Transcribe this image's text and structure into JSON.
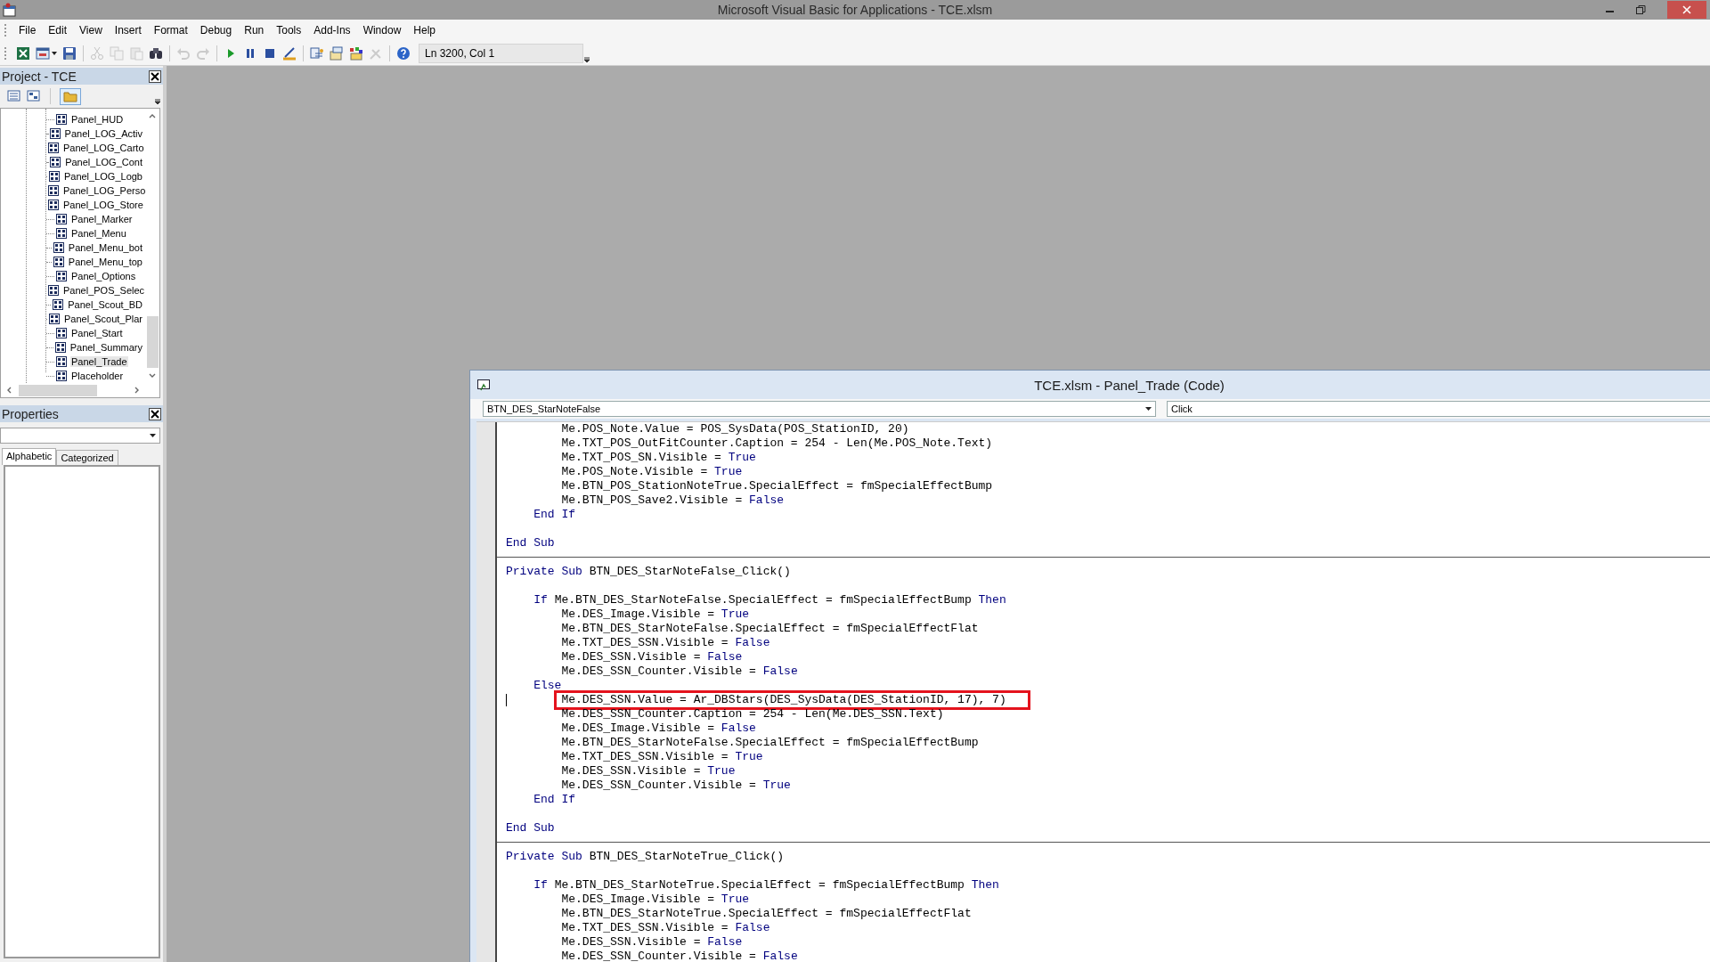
{
  "window": {
    "title": "Microsoft Visual Basic for Applications - TCE.xlsm"
  },
  "menu": [
    "File",
    "Edit",
    "View",
    "Insert",
    "Format",
    "Debug",
    "Run",
    "Tools",
    "Add-Ins",
    "Window",
    "Help"
  ],
  "toolbar": {
    "groups": [
      [
        {
          "kind": "excel",
          "disabled": false
        },
        {
          "kind": "userform",
          "disabled": false
        },
        {
          "kind": "save",
          "disabled": false
        }
      ],
      [
        {
          "kind": "cut",
          "disabled": true
        },
        {
          "kind": "copy",
          "disabled": true
        },
        {
          "kind": "paste",
          "disabled": true
        },
        {
          "kind": "find",
          "disabled": false
        }
      ],
      [
        {
          "kind": "undo",
          "disabled": true
        },
        {
          "kind": "redo",
          "disabled": true
        }
      ],
      [
        {
          "kind": "run",
          "disabled": false
        },
        {
          "kind": "pause",
          "disabled": false
        },
        {
          "kind": "stop",
          "disabled": false
        },
        {
          "kind": "design",
          "disabled": false
        }
      ],
      [
        {
          "kind": "project",
          "disabled": false
        },
        {
          "kind": "properties",
          "disabled": false
        },
        {
          "kind": "browser",
          "disabled": false
        },
        {
          "kind": "toolbox",
          "disabled": true
        }
      ],
      [
        {
          "kind": "help",
          "disabled": false
        }
      ]
    ],
    "position": "Ln 3200, Col 1"
  },
  "project": {
    "title": "Project - TCE",
    "items": [
      {
        "label": "Panel_HUD",
        "selected": false
      },
      {
        "label": "Panel_LOG_Activ",
        "selected": false
      },
      {
        "label": "Panel_LOG_Carto",
        "selected": false
      },
      {
        "label": "Panel_LOG_Cont",
        "selected": false
      },
      {
        "label": "Panel_LOG_Logb",
        "selected": false
      },
      {
        "label": "Panel_LOG_Perso",
        "selected": false
      },
      {
        "label": "Panel_LOG_Store",
        "selected": false
      },
      {
        "label": "Panel_Marker",
        "selected": false
      },
      {
        "label": "Panel_Menu",
        "selected": false
      },
      {
        "label": "Panel_Menu_bot",
        "selected": false
      },
      {
        "label": "Panel_Menu_top",
        "selected": false
      },
      {
        "label": "Panel_Options",
        "selected": false
      },
      {
        "label": "Panel_POS_Selec",
        "selected": false
      },
      {
        "label": "Panel_Scout_BD",
        "selected": false
      },
      {
        "label": "Panel_Scout_Plar",
        "selected": false
      },
      {
        "label": "Panel_Start",
        "selected": false
      },
      {
        "label": "Panel_Summary",
        "selected": false
      },
      {
        "label": "Panel_Trade",
        "selected": true
      },
      {
        "label": "Placeholder",
        "selected": false
      }
    ]
  },
  "properties": {
    "title": "Properties",
    "tabs": [
      {
        "label": "Alphabetic",
        "selected": true
      },
      {
        "label": "Categorized",
        "selected": false
      }
    ]
  },
  "code_window": {
    "title": "TCE.xlsm - Panel_Trade (Code)",
    "object": "BTN_DES_StarNoteFalse",
    "procedure": "Click",
    "procedures": [
      {
        "blocks": [
          [
            {
              "tokens": [
                {
                  "text": "        Me.POS_Note.Value = POS_SysData(POS_StationID, 20)",
                  "kind": "plain"
                }
              ],
              "highlighted": false
            },
            {
              "tokens": [
                {
                  "text": "        Me.TXT_POS_OutFitCounter.Caption = 254 - Len(Me.POS_Note.Text)",
                  "kind": "plain"
                }
              ],
              "highlighted": false
            },
            {
              "tokens": [
                {
                  "text": "        Me.TXT_POS_SN.Visible = ",
                  "kind": "plain"
                },
                {
                  "text": "True",
                  "kind": "keyword"
                }
              ],
              "highlighted": false
            },
            {
              "tokens": [
                {
                  "text": "        Me.POS_Note.Visible = ",
                  "kind": "plain"
                },
                {
                  "text": "True",
                  "kind": "keyword"
                }
              ],
              "highlighted": false
            },
            {
              "tokens": [
                {
                  "text": "        Me.BTN_POS_StationNoteTrue.SpecialEffect = fmSpecialEffectBump",
                  "kind": "plain"
                }
              ],
              "highlighted": false
            },
            {
              "tokens": [
                {
                  "text": "        Me.BTN_POS_Save2.Visible = ",
                  "kind": "plain"
                },
                {
                  "text": "False",
                  "kind": "keyword"
                }
              ],
              "highlighted": false
            },
            {
              "tokens": [
                {
                  "text": "    End If",
                  "kind": "keyword"
                }
              ],
              "highlighted": false
            }
          ],
          [
            {
              "tokens": [
                {
                  "text": "End Sub",
                  "kind": "keyword"
                }
              ],
              "highlighted": false
            }
          ]
        ]
      },
      {
        "blocks": [
          [
            {
              "tokens": [
                {
                  "text": "Private Sub",
                  "kind": "keyword"
                },
                {
                  "text": " BTN_DES_StarNoteFalse_Click()",
                  "kind": "plain"
                }
              ],
              "highlighted": false
            }
          ],
          [
            {
              "tokens": [
                {
                  "text": "    If",
                  "kind": "keyword"
                },
                {
                  "text": " Me.BTN_DES_StarNoteFalse.SpecialEffect = fmSpecialEffectBump ",
                  "kind": "plain"
                },
                {
                  "text": "Then",
                  "kind": "keyword"
                }
              ],
              "highlighted": false
            },
            {
              "tokens": [
                {
                  "text": "        Me.DES_Image.Visible = ",
                  "kind": "plain"
                },
                {
                  "text": "True",
                  "kind": "keyword"
                }
              ],
              "highlighted": false
            },
            {
              "tokens": [
                {
                  "text": "        Me.BTN_DES_StarNoteFalse.SpecialEffect = fmSpecialEffectFlat",
                  "kind": "plain"
                }
              ],
              "highlighted": false
            },
            {
              "tokens": [
                {
                  "text": "        Me.TXT_DES_SSN.Visible = ",
                  "kind": "plain"
                },
                {
                  "text": "False",
                  "kind": "keyword"
                }
              ],
              "highlighted": false
            },
            {
              "tokens": [
                {
                  "text": "        Me.DES_SSN.Visible = ",
                  "kind": "plain"
                },
                {
                  "text": "False",
                  "kind": "keyword"
                }
              ],
              "highlighted": false
            },
            {
              "tokens": [
                {
                  "text": "        Me.DES_SSN_Counter.Visible = ",
                  "kind": "plain"
                },
                {
                  "text": "False",
                  "kind": "keyword"
                }
              ],
              "highlighted": false
            },
            {
              "tokens": [
                {
                  "text": "    Else",
                  "kind": "keyword"
                }
              ],
              "highlighted": false
            },
            {
              "tokens": [
                {
                  "text": "        Me.DES_SSN.Value = Ar_DBStars(DES_SysData(DES_StationID, 17), 7)",
                  "kind": "plain"
                }
              ],
              "highlighted": true,
              "cursor": true
            },
            {
              "tokens": [
                {
                  "text": "        Me.DES_SSN_Counter.Caption = 254 - Len(Me.DES_SSN.Text)",
                  "kind": "plain"
                }
              ],
              "highlighted": false
            },
            {
              "tokens": [
                {
                  "text": "        Me.DES_Image.Visible = ",
                  "kind": "plain"
                },
                {
                  "text": "False",
                  "kind": "keyword"
                }
              ],
              "highlighted": false
            },
            {
              "tokens": [
                {
                  "text": "        Me.BTN_DES_StarNoteFalse.SpecialEffect = fmSpecialEffectBump",
                  "kind": "plain"
                }
              ],
              "highlighted": false
            },
            {
              "tokens": [
                {
                  "text": "        Me.TXT_DES_SSN.Visible = ",
                  "kind": "plain"
                },
                {
                  "text": "True",
                  "kind": "keyword"
                }
              ],
              "highlighted": false
            },
            {
              "tokens": [
                {
                  "text": "        Me.DES_SSN.Visible = ",
                  "kind": "plain"
                },
                {
                  "text": "True",
                  "kind": "keyword"
                }
              ],
              "highlighted": false
            },
            {
              "tokens": [
                {
                  "text": "        Me.DES_SSN_Counter.Visible = ",
                  "kind": "plain"
                },
                {
                  "text": "True",
                  "kind": "keyword"
                }
              ],
              "highlighted": false
            },
            {
              "tokens": [
                {
                  "text": "    End If",
                  "kind": "keyword"
                }
              ],
              "highlighted": false
            }
          ],
          [
            {
              "tokens": [
                {
                  "text": "End Sub",
                  "kind": "keyword"
                }
              ],
              "highlighted": false
            }
          ]
        ]
      },
      {
        "blocks": [
          [
            {
              "tokens": [
                {
                  "text": "Private Sub",
                  "kind": "keyword"
                },
                {
                  "text": " BTN_DES_StarNoteTrue_Click()",
                  "kind": "plain"
                }
              ],
              "highlighted": false
            }
          ],
          [
            {
              "tokens": [
                {
                  "text": "    If",
                  "kind": "keyword"
                },
                {
                  "text": " Me.BTN_DES_StarNoteTrue.SpecialEffect = fmSpecialEffectBump ",
                  "kind": "plain"
                },
                {
                  "text": "Then",
                  "kind": "keyword"
                }
              ],
              "highlighted": false
            },
            {
              "tokens": [
                {
                  "text": "        Me.DES_Image.Visible = ",
                  "kind": "plain"
                },
                {
                  "text": "True",
                  "kind": "keyword"
                }
              ],
              "highlighted": false
            },
            {
              "tokens": [
                {
                  "text": "        Me.BTN_DES_StarNoteTrue.SpecialEffect = fmSpecialEffectFlat",
                  "kind": "plain"
                }
              ],
              "highlighted": false
            },
            {
              "tokens": [
                {
                  "text": "        Me.TXT_DES_SSN.Visible = ",
                  "kind": "plain"
                },
                {
                  "text": "False",
                  "kind": "keyword"
                }
              ],
              "highlighted": false
            },
            {
              "tokens": [
                {
                  "text": "        Me.DES_SSN.Visible = ",
                  "kind": "plain"
                },
                {
                  "text": "False",
                  "kind": "keyword"
                }
              ],
              "highlighted": false
            },
            {
              "tokens": [
                {
                  "text": "        Me.DES_SSN_Counter.Visible = ",
                  "kind": "plain"
                },
                {
                  "text": "False",
                  "kind": "keyword"
                }
              ],
              "highlighted": false
            }
          ]
        ]
      }
    ]
  }
}
